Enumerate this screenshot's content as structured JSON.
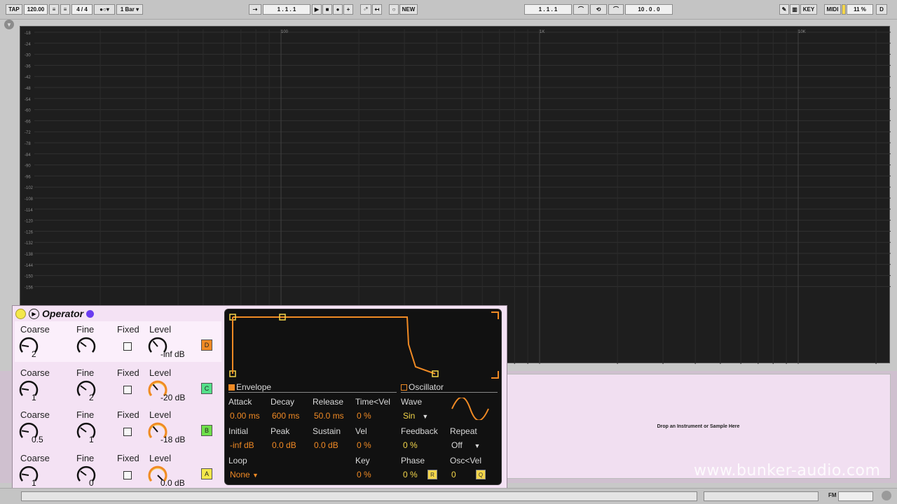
{
  "toolbar": {
    "tap": "TAP",
    "tempo": "120.00",
    "signature": "4 / 4",
    "quantize": "1 Bar",
    "arrangement_position": "1 .  1 .  1",
    "new": "NEW",
    "loop_start": "1 .  1 .  1",
    "loop_length": "10 .  0 .  0",
    "key": "KEY",
    "midi": "MIDI",
    "cpu": "11 %",
    "d": "D"
  },
  "spectrum": {
    "db_labels": [
      "-18",
      "-24",
      "-30",
      "-36",
      "-42",
      "-48",
      "-54",
      "-60",
      "-66",
      "-72",
      "-78",
      "-84",
      "-90",
      "-96",
      "-102",
      "-108",
      "-114",
      "-120",
      "-126",
      "-132",
      "-138",
      "-144",
      "-150",
      "-156"
    ],
    "freq_labels": [
      "100",
      "1K",
      "10K"
    ]
  },
  "operator": {
    "title": "Operator",
    "rows": [
      {
        "id": "D",
        "coarse_label": "Coarse",
        "fine_label": "Fine",
        "fixed_label": "Fixed",
        "level_label": "Level",
        "coarse": "2",
        "fine": "",
        "level": "-inf dB",
        "tag": "D",
        "tag_color": "#f08a24"
      },
      {
        "id": "C",
        "coarse_label": "Coarse",
        "fine_label": "Fine",
        "fixed_label": "Fixed",
        "level_label": "Level",
        "coarse": "1",
        "fine": "2",
        "level": "-20 dB",
        "tag": "C",
        "tag_color": "#55e08a"
      },
      {
        "id": "B",
        "coarse_label": "Coarse",
        "fine_label": "Fine",
        "fixed_label": "Fixed",
        "level_label": "Level",
        "coarse": "0.5",
        "fine": "1",
        "level": "-18 dB",
        "tag": "B",
        "tag_color": "#6ee04a"
      },
      {
        "id": "A",
        "coarse_label": "Coarse",
        "fine_label": "Fine",
        "fixed_label": "Fixed",
        "level_label": "Level",
        "coarse": "1",
        "fine": "0",
        "level": "0.0 dB",
        "tag": "A",
        "tag_color": "#f4e84a"
      }
    ]
  },
  "envelope": {
    "section_label": "Envelope",
    "attack_label": "Attack",
    "attack": "0.00 ms",
    "decay_label": "Decay",
    "decay": "600 ms",
    "release_label": "Release",
    "release": "50.0 ms",
    "timevel_label": "Time<Vel",
    "timevel": "0 %",
    "initial_label": "Initial",
    "initial": "-inf dB",
    "peak_label": "Peak",
    "peak": "0.0 dB",
    "sustain_label": "Sustain",
    "sustain": "0.0 dB",
    "vel_label": "Vel",
    "vel": "0 %",
    "loop_label": "Loop",
    "loop": "None",
    "key_label": "Key",
    "key": "0 %"
  },
  "oscillator": {
    "section_label": "Oscillator",
    "wave_label": "Wave",
    "wave": "Sin",
    "feedback_label": "Feedback",
    "feedback": "0 %",
    "repeat_label": "Repeat",
    "repeat": "Off",
    "phase_label": "Phase",
    "phase": "0 %",
    "r_button": "R",
    "oscvel_label": "Osc<Vel",
    "oscvel": "0",
    "q_button": "Q"
  },
  "drop_zone": "Drop an Instrument or Sample Here",
  "watermark": "www.bunker-audio.com",
  "bottombar": {
    "fm": "FM"
  },
  "colors": {
    "accent_orange": "#f08a24",
    "accent_yellow": "#f4d64a",
    "panel_pink": "#f4e2f4"
  }
}
